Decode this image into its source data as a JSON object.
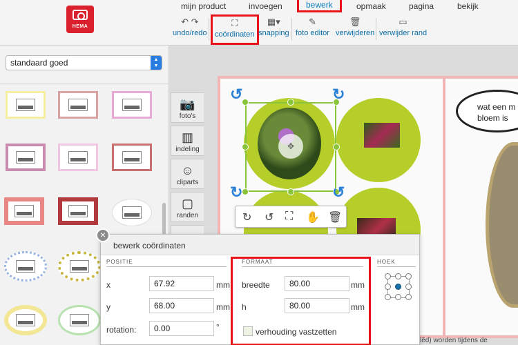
{
  "logo": {
    "text": "HEMA"
  },
  "menu": {
    "tabs": [
      {
        "label": "mijn product"
      },
      {
        "label": "invoegen"
      },
      {
        "label": "bewerk",
        "active": true
      },
      {
        "label": "opmaak"
      },
      {
        "label": "pagina"
      },
      {
        "label": "bekijk"
      }
    ]
  },
  "toolbar": {
    "undo_redo": "undo/redo",
    "coordinaten": "coördinaten",
    "snapping": "snapping",
    "foto_editor": "foto editor",
    "verwijderen": "verwijderen",
    "verwijder_rand": "verwijder rand"
  },
  "leftpanel": {
    "dropdown_value": "standaard goed",
    "frame_colors": [
      "#f4eea0",
      "#d9a3a3",
      "#e8a9d4",
      "#c98bb0",
      "#f1c6e2",
      "#c7706f",
      "#e98787",
      "#b03a3e",
      "#ffffff",
      "#9bb4e0",
      "#c8b640",
      "#f3e694",
      "#b8e3b0"
    ]
  },
  "sidetabs": [
    {
      "label": "foto's",
      "icon": "camera-icon"
    },
    {
      "label": "indeling",
      "icon": "layout-icon"
    },
    {
      "label": "cliparts",
      "icon": "smiley-icon"
    },
    {
      "label": "randen",
      "icon": "frame-icon"
    }
  ],
  "canvas": {
    "speech_bubble": "wat een m\nbloem is",
    "accent_color": "#b6ce2a"
  },
  "dialog": {
    "title": "bewerk coördinaten",
    "positie": {
      "heading": "POSITIE",
      "x_label": "x",
      "x_value": "67.92",
      "x_unit": "mm",
      "y_label": "y",
      "y_value": "68.00",
      "y_unit": "mm",
      "rotation_label": "rotation:",
      "rotation_value": "0.00",
      "rotation_unit": "°"
    },
    "formaat": {
      "heading": "FORMAAT",
      "breedte_label": "breedte",
      "breedte_value": "80.00",
      "breedte_unit": "mm",
      "h_label": "h",
      "h_value": "80.00",
      "h_unit": "mm",
      "lock_label": "verhouding vastzetten"
    },
    "hoek": {
      "heading": "HOEK"
    }
  },
  "footer": {
    "note": "lêd) worden tijdens de"
  }
}
